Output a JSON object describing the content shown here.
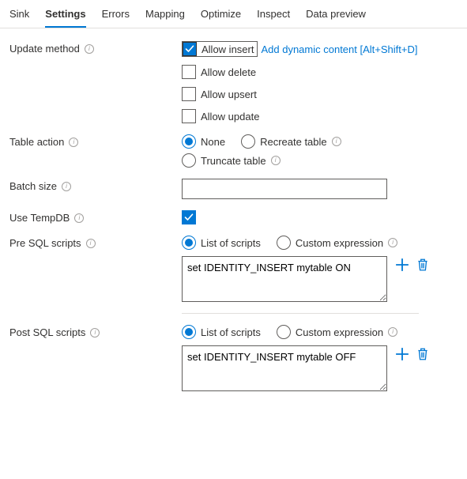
{
  "tabs": {
    "sink": "Sink",
    "settings": "Settings",
    "errors": "Errors",
    "mapping": "Mapping",
    "optimize": "Optimize",
    "inspect": "Inspect",
    "dataPreview": "Data preview"
  },
  "updateMethod": {
    "label": "Update method",
    "allowInsert": "Allow insert",
    "allowDelete": "Allow delete",
    "allowUpsert": "Allow upsert",
    "allowUpdate": "Allow update",
    "dynamicLink": "Add dynamic content [Alt+Shift+D]"
  },
  "tableAction": {
    "label": "Table action",
    "none": "None",
    "recreate": "Recreate table",
    "truncate": "Truncate table"
  },
  "batchSize": {
    "label": "Batch size",
    "value": ""
  },
  "useTempDB": {
    "label": "Use TempDB"
  },
  "preSql": {
    "label": "Pre SQL scripts",
    "listOfScripts": "List of scripts",
    "customExpression": "Custom expression",
    "script": "set IDENTITY_INSERT mytable ON"
  },
  "postSql": {
    "label": "Post SQL scripts",
    "listOfScripts": "List of scripts",
    "customExpression": "Custom expression",
    "script": "set IDENTITY_INSERT mytable OFF"
  }
}
